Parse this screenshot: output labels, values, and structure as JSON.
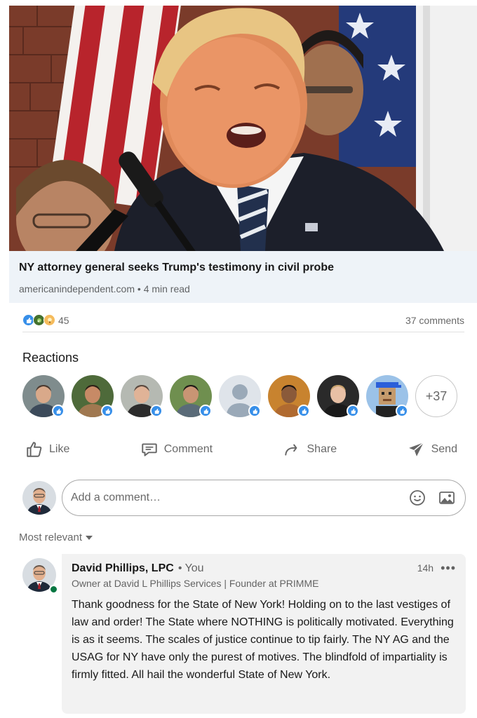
{
  "article": {
    "title": "NY attorney general seeks Trump's testimony in civil probe",
    "source": "americanindependent.com",
    "read_time": "4 min read",
    "separator": " • "
  },
  "social": {
    "reaction_icons": [
      "like-icon",
      "celebrate-icon",
      "insightful-icon"
    ],
    "reaction_count": "45",
    "comments_count": "37 comments"
  },
  "reactions": {
    "heading": "Reactions",
    "more_count": "+37",
    "faces": [
      {
        "name": "reactor-1",
        "skin": "#d9a98a",
        "hair": "#4a3a30",
        "bg": "#7f8c8d",
        "shirt": "#3c4a5a"
      },
      {
        "name": "reactor-2",
        "skin": "#c78a66",
        "hair": "#2b2016",
        "bg": "#4e6a3a",
        "shirt": "#a07850"
      },
      {
        "name": "reactor-3",
        "skin": "#e0b397",
        "hair": "#5a4a40",
        "bg": "#b5b9b2",
        "shirt": "#2c2c2c"
      },
      {
        "name": "reactor-4",
        "skin": "#c99574",
        "hair": "#1e1a16",
        "bg": "#6f8f4f",
        "shirt": "#5a6b78"
      },
      {
        "name": "reactor-5-placeholder",
        "skin": "#9aa9b8",
        "hair": "#9aa9b8",
        "bg": "#dfe4ea",
        "shirt": "#9aa9b8"
      },
      {
        "name": "reactor-6",
        "skin": "#8a5a3a",
        "hair": "#1e1410",
        "bg": "#c8832f",
        "shirt": "#b06a30"
      },
      {
        "name": "reactor-7",
        "skin": "#e8c0a5",
        "hair": "#c7a26d",
        "bg": "#2a2a2a",
        "shirt": "#1a1a1a"
      },
      {
        "name": "reactor-8-pixel",
        "skin": "#c49a6c",
        "hair": "#2b5fd9",
        "bg": "#9bc2e8",
        "shirt": "#222222"
      }
    ]
  },
  "actions": {
    "like": "Like",
    "comment": "Comment",
    "share": "Share",
    "send": "Send"
  },
  "comment_box": {
    "placeholder": "Add a comment…"
  },
  "sort": {
    "label": "Most relevant"
  },
  "comment": {
    "author": "David Phillips, LPC",
    "you_badge": "• You",
    "timestamp": "14h",
    "more": "•••",
    "headline": "Owner at David L Phillips Services | Founder at PRIMME",
    "text": "Thank goodness for the State of New York! Holding on to the last vestiges of law and order! The State where NOTHING is politically motivated. Everything is as it seems. The scales of justice continue to tip fairly. The NY AG and the USAG for NY have only the purest of motives. The blindfold of impartiality is firmly fitted. All hail the wonderful State of New York."
  },
  "colors": {
    "like_blue": "#378fe9",
    "link_bg": "#eef3f8",
    "online_green": "#057642"
  }
}
